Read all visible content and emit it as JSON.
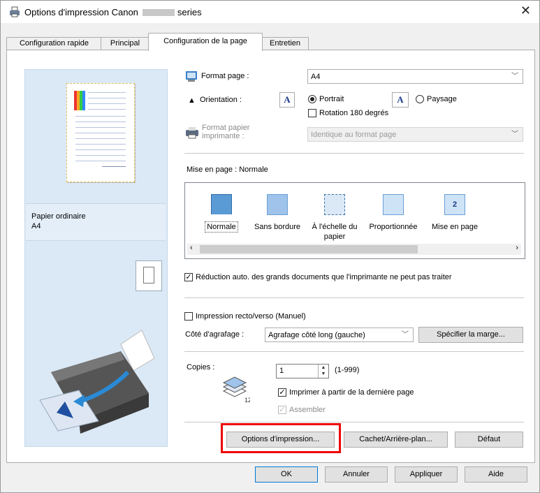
{
  "title": "Options d'impression Canon",
  "title_suffix": "series",
  "close_symbol": "✕",
  "tabs": [
    "Configuration rapide",
    "Principal",
    "Configuration de la page",
    "Entretien"
  ],
  "preview": {
    "paper_type": "Papier ordinaire",
    "paper_size": "A4"
  },
  "page_size": {
    "label": "Format page :",
    "value": "A4"
  },
  "orientation": {
    "label": "Orientation :",
    "portrait": "Portrait",
    "landscape": "Paysage",
    "rotate": "Rotation 180 degrés",
    "selected": "Portrait"
  },
  "printer_paper": {
    "label_line1": "Format papier",
    "label_line2": "imprimante :",
    "value": "Identique au format page"
  },
  "layout": {
    "label": "Mise en page : Normale",
    "items": [
      "Normale",
      "Sans bordure",
      "À l'échelle du papier",
      "Proportionnée",
      "Mise en page"
    ],
    "selected": "Normale"
  },
  "auto_reduce": "Réduction auto. des grands documents que l'imprimante ne peut pas traiter",
  "duplex": "Impression recto/verso (Manuel)",
  "stapling": {
    "label": "Côté d'agrafage :",
    "value": "Agrafage côté long (gauche)",
    "button": "Spécifier la marge..."
  },
  "copies": {
    "label": "Copies :",
    "value": "1",
    "range": "(1-999)",
    "last_page": "Imprimer à partir de la dernière page",
    "collate": "Assembler"
  },
  "buttons": {
    "print_options": "Options d'impression...",
    "stamp": "Cachet/Arrière-plan...",
    "default": "Défaut",
    "ok": "OK",
    "cancel": "Annuler",
    "apply": "Appliquer",
    "help": "Aide"
  }
}
